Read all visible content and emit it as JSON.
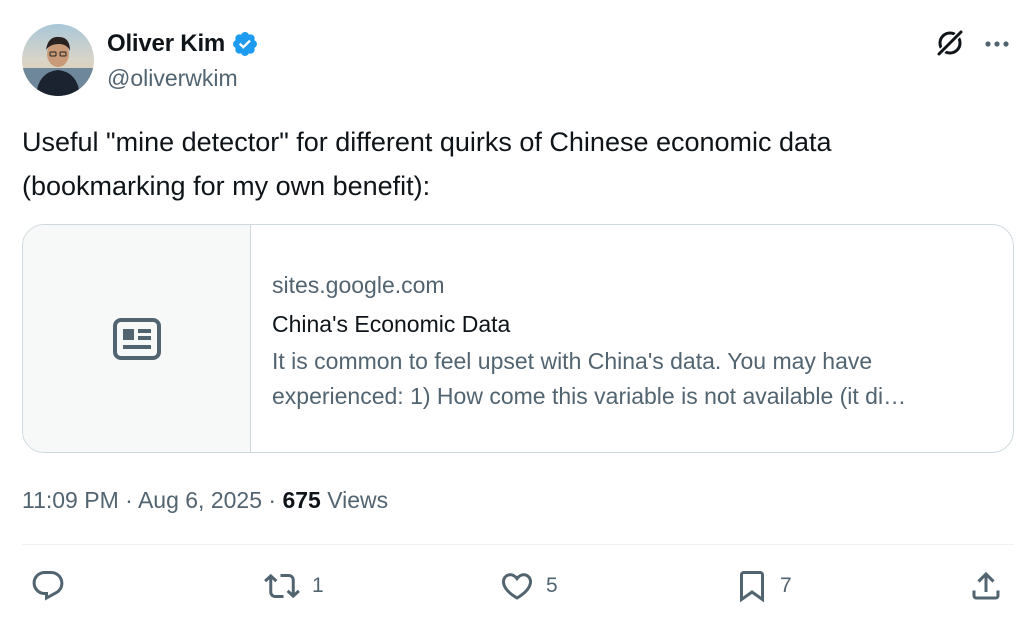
{
  "author": {
    "display_name": "Oliver Kim",
    "handle": "@oliverwkim",
    "verified": true,
    "verified_color": "#1d9bf0"
  },
  "tweet": {
    "text_line1": "Useful \"mine detector\" for different quirks of Chinese economic data",
    "text_line2": "(bookmarking for my own benefit):"
  },
  "card": {
    "domain": "sites.google.com",
    "title": "China's Economic Data",
    "description_line1": "It is common to feel upset with China's data. You may have",
    "description_line2": "experienced: 1) How come this variable is not available (it di…",
    "media_icon": "article-icon"
  },
  "meta": {
    "time": "11:09 PM",
    "separator": "·",
    "date": "Aug 6, 2025",
    "views_count": "675",
    "views_label": "Views"
  },
  "actions": {
    "reply_icon": "reply-icon",
    "retweet_count": "1",
    "like_count": "5",
    "bookmark_count": "7",
    "share_icon": "share-icon"
  },
  "colors": {
    "text_primary": "#0f1419",
    "text_secondary": "#536471",
    "border": "#cfd9de"
  }
}
